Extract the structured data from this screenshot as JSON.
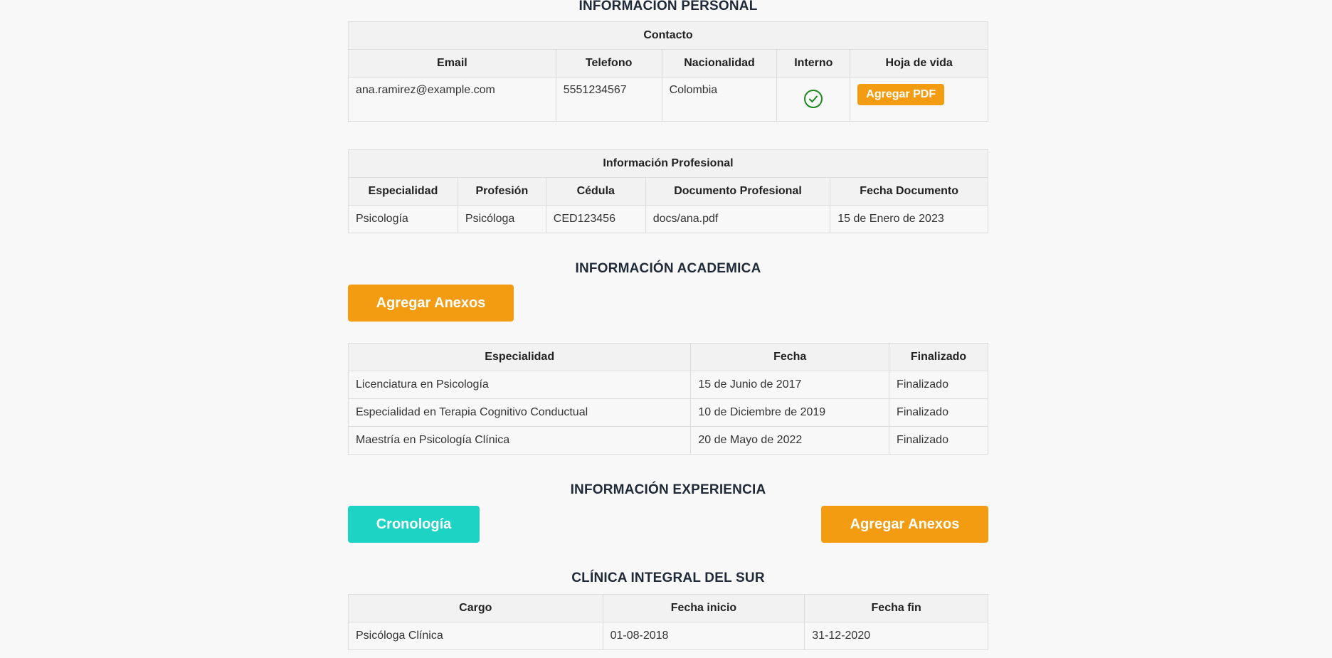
{
  "personal": {
    "title": "INFORMACIÓN PERSONAL",
    "contact_caption": "Contacto",
    "headers": [
      "Email",
      "Telefono",
      "Nacionalidad",
      "Interno",
      "Hoja de vida"
    ],
    "row": {
      "email": "ana.ramirez@example.com",
      "phone": "5551234567",
      "nationality": "Colombia",
      "internal": true,
      "cv_button": "Agregar PDF"
    }
  },
  "professional": {
    "caption": "Información Profesional",
    "headers": [
      "Especialidad",
      "Profesión",
      "Cédula",
      "Documento Profesional",
      "Fecha Documento"
    ],
    "row": [
      "Psicología",
      "Psicóloga",
      "CED123456",
      "docs/ana.pdf",
      "15 de Enero de 2023"
    ]
  },
  "academic": {
    "title": "INFORMACIÓN ACADEMICA",
    "add_button": "Agregar Anexos",
    "headers": [
      "Especialidad",
      "Fecha",
      "Finalizado"
    ],
    "rows": [
      [
        "Licenciatura en Psicología",
        "15 de Junio de 2017",
        "Finalizado"
      ],
      [
        "Especialidad en Terapia Cognitivo Conductual",
        "10 de Diciembre de 2019",
        "Finalizado"
      ],
      [
        "Maestría en Psicología Clínica",
        "20 de Mayo de 2022",
        "Finalizado"
      ]
    ]
  },
  "experience": {
    "title": "INFORMACIÓN EXPERIENCIA",
    "timeline_button": "Cronología",
    "add_button": "Agregar Anexos",
    "company": "CLÍNICA INTEGRAL DEL SUR",
    "headers": [
      "Cargo",
      "Fecha inicio",
      "Fecha fin"
    ],
    "rows": [
      [
        "Psicóloga Clínica",
        "01-08-2018",
        "31-12-2020"
      ]
    ]
  },
  "colors": {
    "orange": "#f39c12",
    "teal": "#1dd3c4",
    "check_green": "#1a8a1a"
  }
}
